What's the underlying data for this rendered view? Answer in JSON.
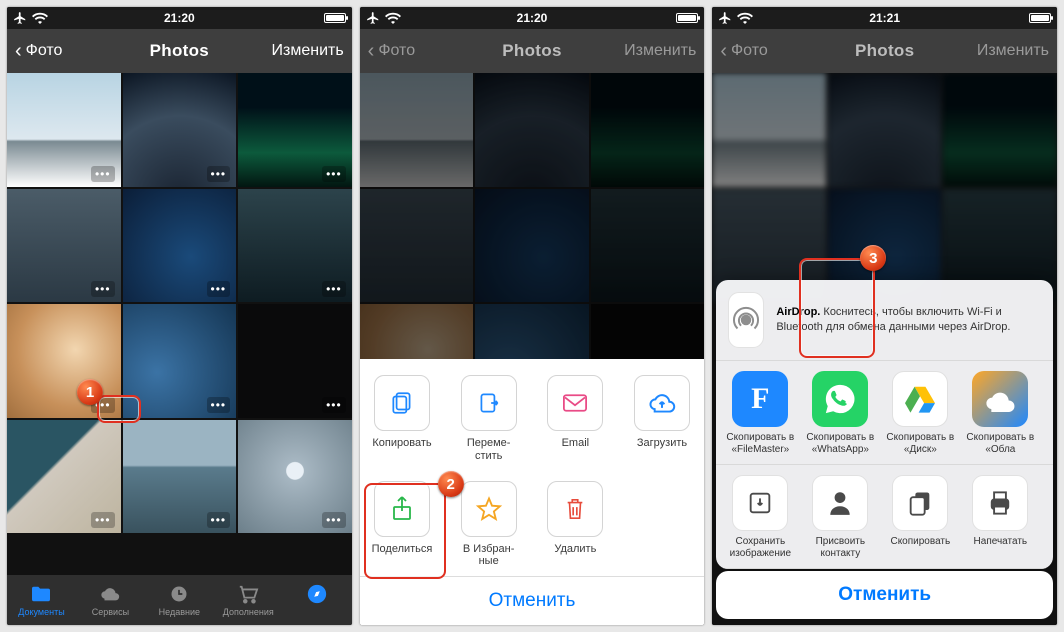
{
  "status": {
    "time1": "21:20",
    "time2": "21:20",
    "time3": "21:21"
  },
  "nav": {
    "back": "Фото",
    "title": "Photos",
    "edit": "Изменить"
  },
  "tabs": {
    "docs": "Документы",
    "services": "Сервисы",
    "recent": "Недавние",
    "addons": "Дополнения"
  },
  "sheet1": {
    "copy": "Копировать",
    "move": "Переме-\nстить",
    "email": "Email",
    "upload": "Загрузить",
    "share": "Поделиться",
    "favorite": "В Избран-\nные",
    "delete": "Удалить",
    "cancel": "Отменить"
  },
  "sheet2": {
    "airdrop_title": "AirDrop.",
    "airdrop_body": "Коснитесь, чтобы включить Wi-Fi и Bluetooth для обмена данными через AirDrop.",
    "apps": {
      "filemaster": "Скопировать в «FileMaster»",
      "whatsapp": "Скопировать в «WhatsApp»",
      "disk": "Скопировать в «Диск»",
      "cloud": "Скопировать в «Обла",
      "f_letter": "F"
    },
    "actions": {
      "save_image": "Сохранить изображение",
      "assign_contact": "Присвоить контакту",
      "copy": "Скопировать",
      "print": "Напечатать"
    },
    "cancel": "Отменить"
  },
  "annotations": {
    "n1": "1",
    "n2": "2",
    "n3": "3"
  },
  "colors": {
    "accent": "#007aff",
    "highlight": "#e03020"
  }
}
